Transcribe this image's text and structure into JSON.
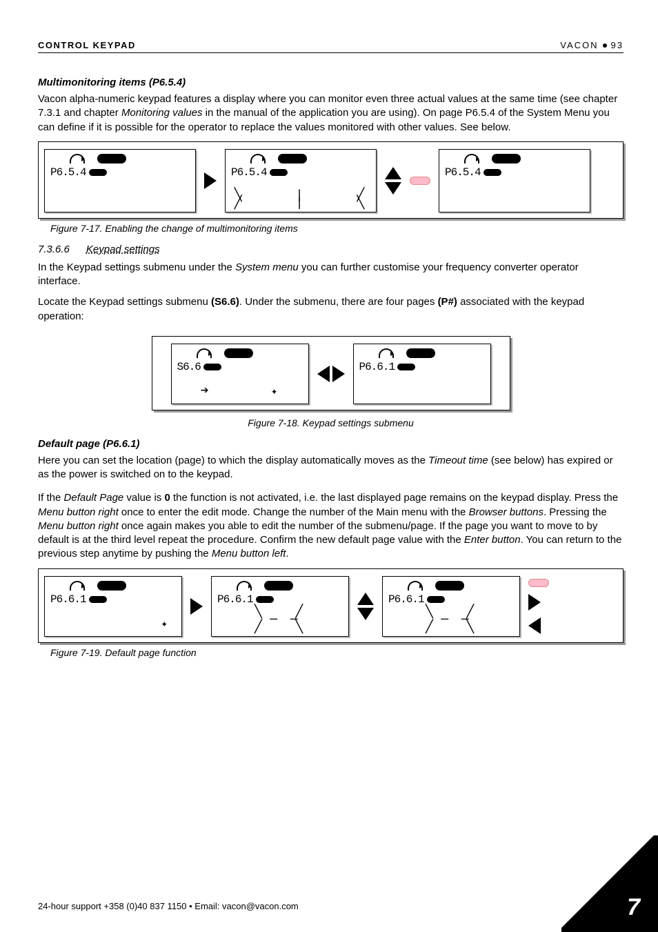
{
  "header": {
    "left": "CONTROL KEYPAD",
    "brand": "VACON",
    "page": "93"
  },
  "s1": {
    "title": "Multimonitoring items (P6.5.4)",
    "p1a": "Vacon alpha-numeric keypad features a display where you can monitor even three actual values at the same time (see chapter 7.3.1 and chapter ",
    "p1i": "Monitoring values",
    "p1b": " in the manual of the application you are using). On page P6.5.4 of the System Menu you can define if it is possible for the operator to replace the values monitored with other values. See below."
  },
  "fig17": {
    "lcd1_code": "P6.5.4",
    "lcd2_code": "P6.5.4",
    "lcd3_code": "P6.5.4",
    "caption": "Figure 7-17. Enabling the change of multimonitoring items"
  },
  "s2": {
    "num": "7.3.6.6",
    "title": "Keypad settings",
    "p1a": "In the Keypad settings submenu under the ",
    "p1i": "System menu",
    "p1b": " you can further customise your frequency converter operator interface.",
    "p2a": "Locate the Keypad settings submenu ",
    "p2b1": "(S6.6)",
    "p2c": ". Under the submenu, there are four pages ",
    "p2b2": "(P#)",
    "p2d": " associated with the keypad operation:"
  },
  "fig18": {
    "lcd1_code": "S6.6",
    "lcd2_code": "P6.6.1",
    "caption": "Figure 7-18. Keypad settings submenu"
  },
  "s3": {
    "title": "Default page (P6.6.1)",
    "p1a": "Here you can set the location (page) to which the display automatically moves as the ",
    "p1i": "Timeout time",
    "p1b": " (see below) has expired or as the power is switched on to the keypad.",
    "p2a": "If the ",
    "p2i1": "Default Page",
    "p2b": " value is ",
    "p2bold": "0",
    "p2c": " the function is not activated, i.e. the last displayed page remains on the keypad display. Press the ",
    "p2i2": "Menu button right",
    "p2d": " once to enter the edit mode. Change the number of the Main menu with the ",
    "p2i3": "Browser buttons",
    "p2e": ". Pressing the ",
    "p2i4": "Menu button right",
    "p2f": " once again makes you able to edit the number of the submenu/page. If the page you want to move to by default is at the third level repeat the procedure. Confirm the new default page value with the ",
    "p2i5": "Enter button",
    "p2g": ". You can return to the previous step anytime by pushing the ",
    "p2i6": "Menu button left",
    "p2h": "."
  },
  "fig19": {
    "lcd1_code": "P6.6.1",
    "lcd2_code": "P6.6.1",
    "lcd3_code": "P6.6.1",
    "caption": "Figure 7-19. Default page function"
  },
  "footer": {
    "text": "24-hour support +358 (0)40 837 1150 • Email: vacon@vacon.com"
  },
  "corner": {
    "chapter": "7"
  }
}
